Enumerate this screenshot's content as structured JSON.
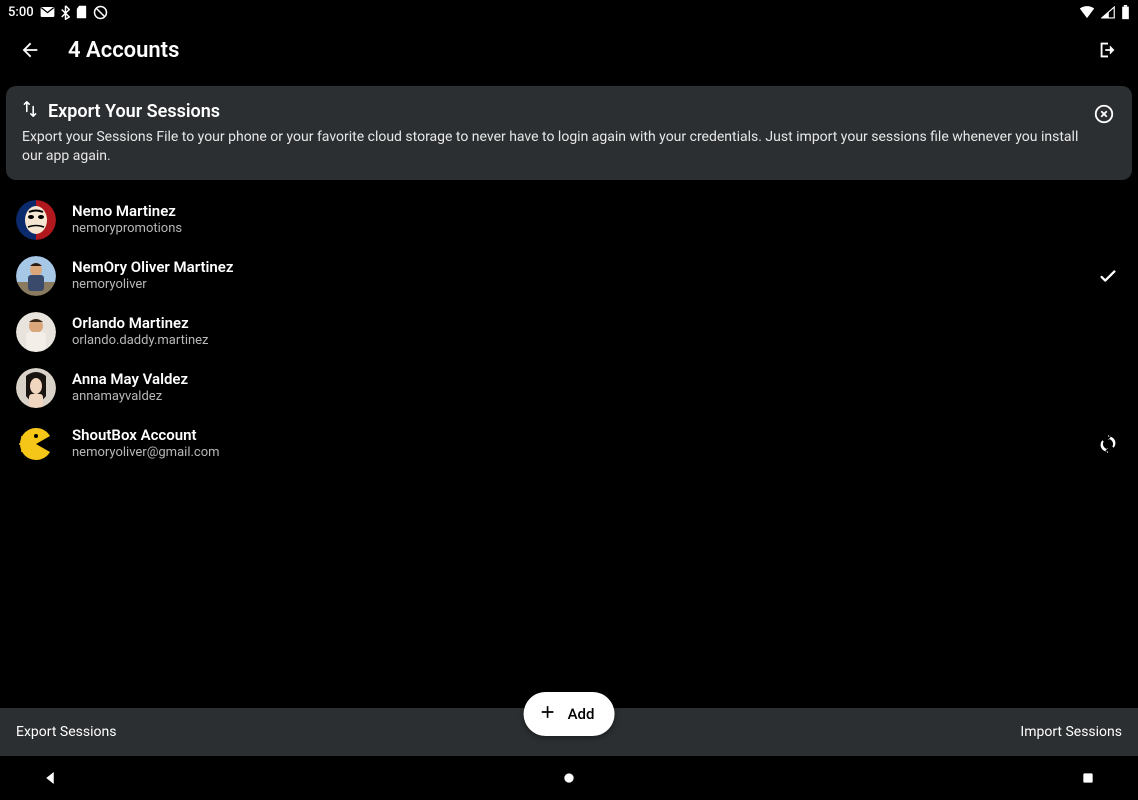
{
  "statusbar": {
    "time": "5:00"
  },
  "appbar": {
    "title": "4 Accounts"
  },
  "banner": {
    "title": "Export Your Sessions",
    "description": "Export your Sessions File to your phone or your favorite cloud storage to never have to login again with your credentials. Just import your sessions file whenever you install our app again."
  },
  "accounts": [
    {
      "name": "Nemo Martinez",
      "handle": "nemorypromotions",
      "avatar": "mask",
      "trail": "none"
    },
    {
      "name": "NemOry Oliver Martinez",
      "handle": "nemoryoliver",
      "avatar": "guy1",
      "trail": "check"
    },
    {
      "name": "Orlando Martinez",
      "handle": "orlando.daddy.martinez",
      "avatar": "guy2",
      "trail": "none"
    },
    {
      "name": "Anna May Valdez",
      "handle": "annamayvaldez",
      "avatar": "girl",
      "trail": "none"
    },
    {
      "name": "ShoutBox Account",
      "handle": "nemoryoliver@gmail.com",
      "avatar": "pacman",
      "trail": "sync"
    }
  ],
  "bottombar": {
    "export": "Export Sessions",
    "import": "Import Sessions"
  },
  "fab": {
    "label": "Add"
  }
}
